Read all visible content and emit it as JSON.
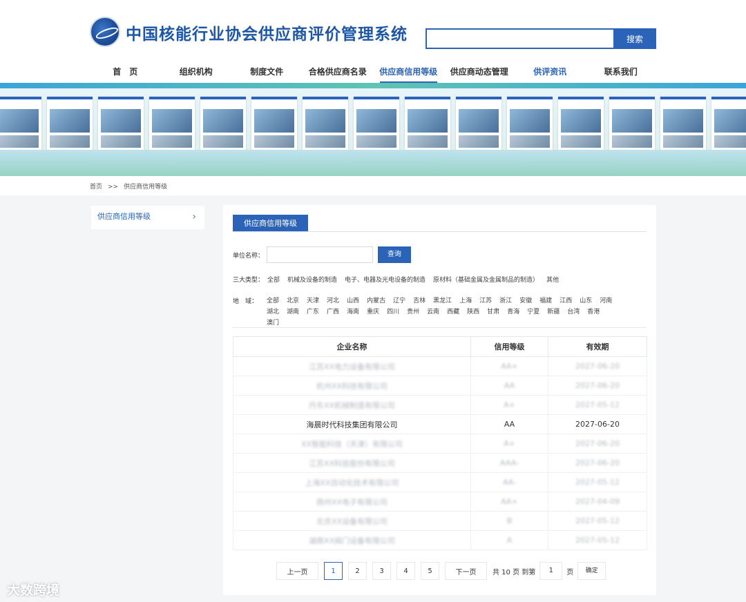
{
  "header": {
    "site_title": "中国核能行业协会供应商评价管理系统",
    "search_button": "搜索"
  },
  "nav": {
    "items": [
      {
        "label": "首　页"
      },
      {
        "label": "组织机构"
      },
      {
        "label": "制度文件"
      },
      {
        "label": "合格供应商名录"
      },
      {
        "label": "供应商信用等级"
      },
      {
        "label": "供应商动态管理"
      },
      {
        "label": "供评资讯"
      },
      {
        "label": "联系我们"
      }
    ]
  },
  "breadcrumb": {
    "home": "首页",
    "separator": ">>",
    "current": "供应商信用等级"
  },
  "sidebar": {
    "item_label": "供应商信用等级",
    "arrow": "›"
  },
  "content": {
    "tab_label": "供应商信用等级",
    "unit_label": "单位名称：",
    "unit_value": "",
    "query_button": "查询",
    "type_label": "三大类型：",
    "types": [
      "全部",
      "机械及设备的制造",
      "电子、电器及光电设备的制造",
      "原材料（基础金属及金属制品的制造）",
      "其他"
    ],
    "region_label": "地　域：",
    "regions": [
      "全部",
      "北京",
      "天津",
      "河北",
      "山西",
      "内蒙古",
      "辽宁",
      "吉林",
      "黑龙江",
      "上海",
      "江苏",
      "浙江",
      "安徽",
      "福建",
      "江西",
      "山东",
      "河南",
      "湖北",
      "湖南",
      "广东",
      "广西",
      "海南",
      "重庆",
      "四川",
      "贵州",
      "云南",
      "西藏",
      "陕西",
      "甘肃",
      "青海",
      "宁夏",
      "新疆",
      "台湾",
      "香港",
      "澳门"
    ]
  },
  "table": {
    "headers": [
      "企业名称",
      "信用等级",
      "有效期"
    ],
    "rows": [
      {
        "name": "江苏XX电力设备有限公司",
        "grade": "AA+",
        "valid": "2027-06-20",
        "highlight": false
      },
      {
        "name": "杭州XX科技有限公司",
        "grade": "AA",
        "valid": "2027-06-20",
        "highlight": false
      },
      {
        "name": "丹东XX机械制造有限公司",
        "grade": "A+",
        "valid": "2027-05-12",
        "highlight": false
      },
      {
        "name": "海晨时代科技集团有限公司",
        "grade": "AA",
        "valid": "2027-06-20",
        "highlight": true
      },
      {
        "name": "XX智能科技（天津）有限公司",
        "grade": "A+",
        "valid": "2027-06-20",
        "highlight": false
      },
      {
        "name": "江苏XX科技股份有限公司",
        "grade": "AAA-",
        "valid": "2027-06-20",
        "highlight": false
      },
      {
        "name": "上海XX自动化技术有限公司",
        "grade": "AA-",
        "valid": "2027-05-12",
        "highlight": false
      },
      {
        "name": "扬州XX电子有限公司",
        "grade": "AA+",
        "valid": "2027-04-09",
        "highlight": false
      },
      {
        "name": "北京XX设备有限公司",
        "grade": "B",
        "valid": "2027-05-12",
        "highlight": false
      },
      {
        "name": "湖南XX阀门设备有限公司",
        "grade": "A",
        "valid": "2027-05-12",
        "highlight": false
      }
    ]
  },
  "pager": {
    "prev": "上一页",
    "pages": [
      "1",
      "2",
      "3",
      "4",
      "5"
    ],
    "current": "1",
    "next": "下一页",
    "total_text": "共 10 页 到第",
    "jump_value": "1",
    "page_unit": "页",
    "confirm": "确定"
  },
  "watermark": "大数跨境"
}
